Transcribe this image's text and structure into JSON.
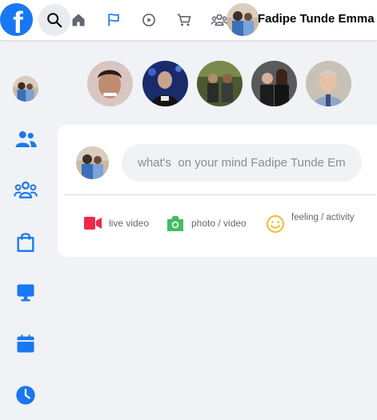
{
  "header": {
    "logo_letter": "f",
    "user_name": "Fadipe Tunde Emma",
    "nav": [
      {
        "icon": "home-icon"
      },
      {
        "icon": "flag-icon"
      },
      {
        "icon": "watch-icon"
      },
      {
        "icon": "marketplace-icon"
      },
      {
        "icon": "groups-icon"
      }
    ]
  },
  "composer": {
    "placeholder": "what's  on your mind Fadipe Tunde Emma",
    "actions": {
      "live": "live video",
      "photo": "photo / video",
      "feeling": "feeling / activity"
    }
  },
  "colors": {
    "brand": "#1877f2",
    "live": "#f02849",
    "photo": "#45bd62",
    "feeling": "#f7b928"
  }
}
